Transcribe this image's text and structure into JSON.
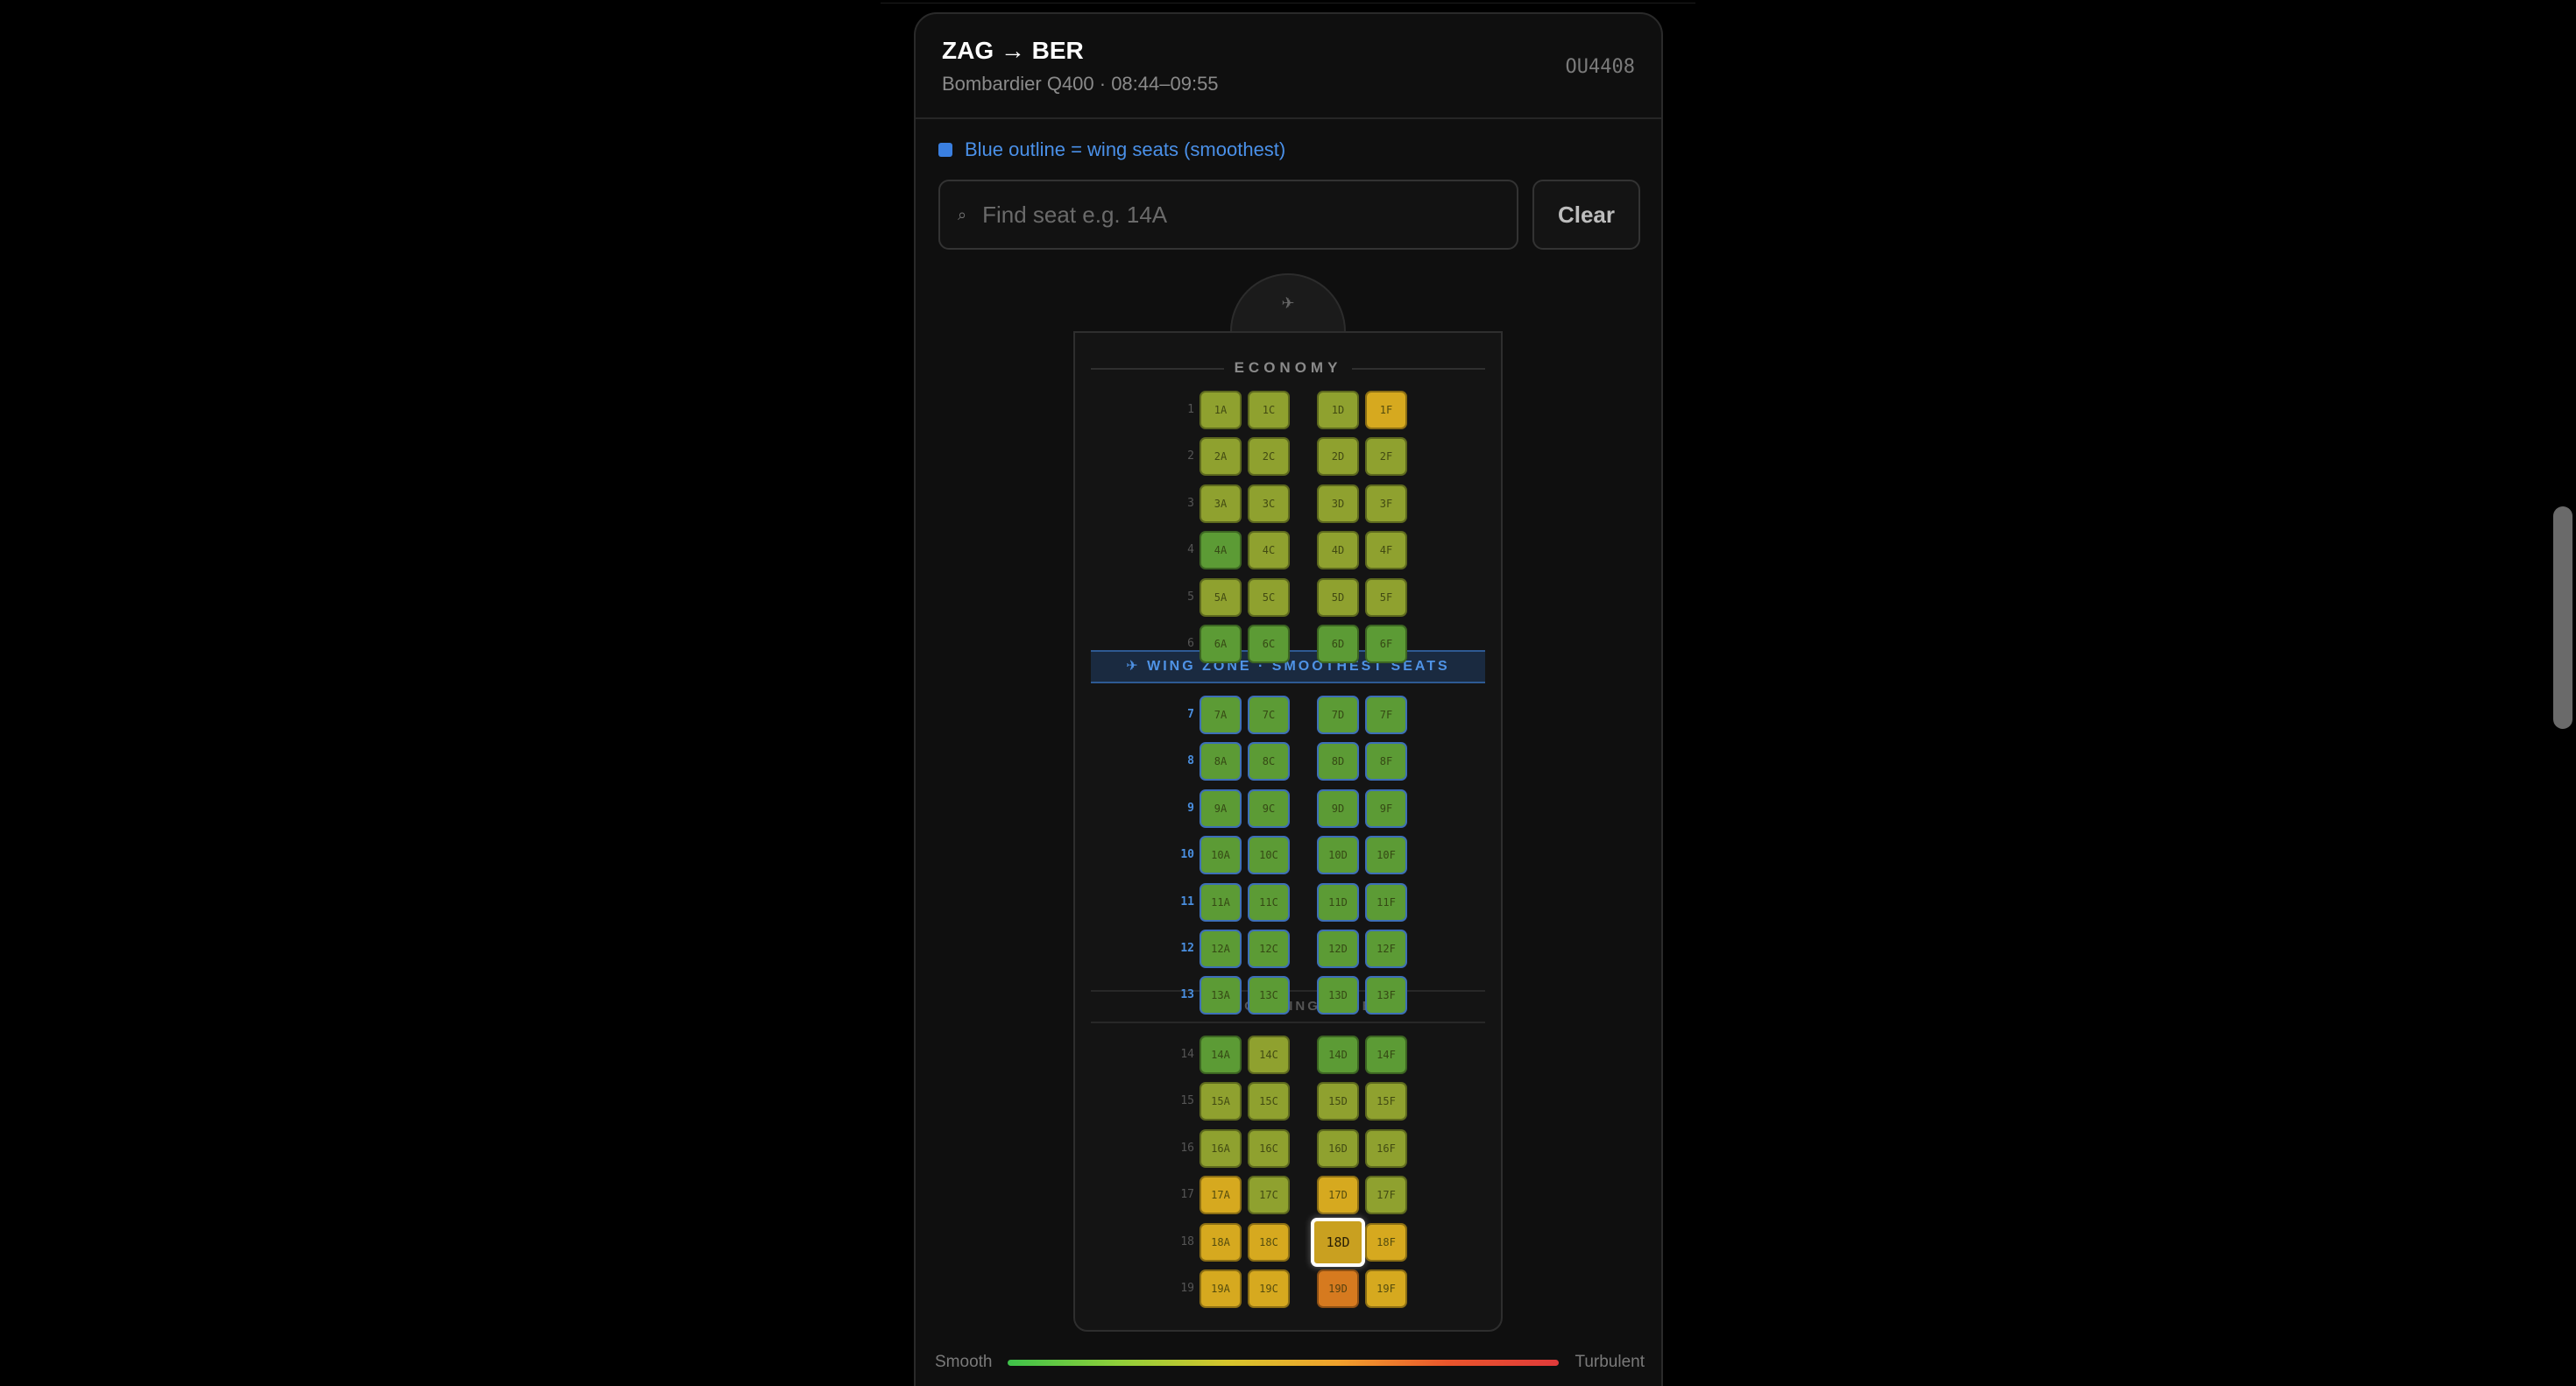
{
  "flight": {
    "route": "ZAG → BER",
    "details": "Bombardier Q400 · 08:44–09:55",
    "number": "OU4408"
  },
  "legend": {
    "text": "Blue outline = wing seats (smoothest)",
    "color": "#3a7fe0"
  },
  "search": {
    "icon": "⌕",
    "placeholder": "Find seat e.g. 14A",
    "value": ""
  },
  "clear_label": "Clear",
  "nose_icon": "✈",
  "cabin": {
    "class_label": "ECONOMY",
    "wing_banner": "✈ WING ZONE · SMOOTHEST SEATS",
    "wing_end": "END OF WING ZONE",
    "columns": [
      "A",
      "C",
      "D",
      "F"
    ],
    "wing_rows": [
      7,
      8,
      9,
      10,
      11,
      12,
      13
    ],
    "selected_seat": "18D",
    "rows": [
      {
        "row": "1",
        "seats": {
          "A": "1A",
          "C": "1C",
          "D": "1D",
          "F": "1F"
        },
        "colors": {
          "A": "#8fa12f",
          "C": "#8fa12f",
          "D": "#8fa12f",
          "F": "#d6a91f"
        }
      },
      {
        "row": "2",
        "seats": {
          "A": "2A",
          "C": "2C",
          "D": "2D",
          "F": "2F"
        },
        "colors": {
          "A": "#8fa12f",
          "C": "#8fa12f",
          "D": "#8fa12f",
          "F": "#8fa12f"
        }
      },
      {
        "row": "3",
        "seats": {
          "A": "3A",
          "C": "3C",
          "D": "3D",
          "F": "3F"
        },
        "colors": {
          "A": "#8fa12f",
          "C": "#8fa12f",
          "D": "#8fa12f",
          "F": "#8fa12f"
        }
      },
      {
        "row": "4",
        "seats": {
          "A": "4A",
          "C": "4C",
          "D": "4D",
          "F": "4F"
        },
        "colors": {
          "A": "#5c9b35",
          "C": "#8fa12f",
          "D": "#8fa12f",
          "F": "#8fa12f"
        }
      },
      {
        "row": "5",
        "seats": {
          "A": "5A",
          "C": "5C",
          "D": "5D",
          "F": "5F"
        },
        "colors": {
          "A": "#8fa12f",
          "C": "#8fa12f",
          "D": "#8fa12f",
          "F": "#8fa12f"
        }
      },
      {
        "row": "6",
        "seats": {
          "A": "6A",
          "C": "6C",
          "D": "6D",
          "F": "6F"
        },
        "colors": {
          "A": "#5c9b35",
          "C": "#5c9b35",
          "D": "#5c9b35",
          "F": "#5c9b35"
        }
      },
      {
        "row": "7",
        "seats": {
          "A": "7A",
          "C": "7C",
          "D": "7D",
          "F": "7F"
        },
        "colors": {
          "A": "#5c9b35",
          "C": "#5c9b35",
          "D": "#5c9b35",
          "F": "#5c9b35"
        }
      },
      {
        "row": "8",
        "seats": {
          "A": "8A",
          "C": "8C",
          "D": "8D",
          "F": "8F"
        },
        "colors": {
          "A": "#5c9b35",
          "C": "#5c9b35",
          "D": "#5c9b35",
          "F": "#5c9b35"
        }
      },
      {
        "row": "9",
        "seats": {
          "A": "9A",
          "C": "9C",
          "D": "9D",
          "F": "9F"
        },
        "colors": {
          "A": "#5c9b35",
          "C": "#5c9b35",
          "D": "#5c9b35",
          "F": "#5c9b35"
        }
      },
      {
        "row": "10",
        "seats": {
          "A": "10A",
          "C": "10C",
          "D": "10D",
          "F": "10F"
        },
        "colors": {
          "A": "#5c9b35",
          "C": "#5c9b35",
          "D": "#5c9b35",
          "F": "#5c9b35"
        }
      },
      {
        "row": "11",
        "seats": {
          "A": "11A",
          "C": "11C",
          "D": "11D",
          "F": "11F"
        },
        "colors": {
          "A": "#5c9b35",
          "C": "#5c9b35",
          "D": "#5c9b35",
          "F": "#5c9b35"
        }
      },
      {
        "row": "12",
        "seats": {
          "A": "12A",
          "C": "12C",
          "D": "12D",
          "F": "12F"
        },
        "colors": {
          "A": "#5c9b35",
          "C": "#5c9b35",
          "D": "#5c9b35",
          "F": "#5c9b35"
        }
      },
      {
        "row": "13",
        "seats": {
          "A": "13A",
          "C": "13C",
          "D": "13D",
          "F": "13F"
        },
        "colors": {
          "A": "#5c9b35",
          "C": "#5c9b35",
          "D": "#5c9b35",
          "F": "#5c9b35"
        }
      },
      {
        "row": "14",
        "seats": {
          "A": "14A",
          "C": "14C",
          "D": "14D",
          "F": "14F"
        },
        "colors": {
          "A": "#5c9b35",
          "C": "#8fa12f",
          "D": "#5c9b35",
          "F": "#5c9b35"
        }
      },
      {
        "row": "15",
        "seats": {
          "A": "15A",
          "C": "15C",
          "D": "15D",
          "F": "15F"
        },
        "colors": {
          "A": "#8fa12f",
          "C": "#8fa12f",
          "D": "#8fa12f",
          "F": "#8fa12f"
        }
      },
      {
        "row": "16",
        "seats": {
          "A": "16A",
          "C": "16C",
          "D": "16D",
          "F": "16F"
        },
        "colors": {
          "A": "#8fa12f",
          "C": "#8fa12f",
          "D": "#8fa12f",
          "F": "#8fa12f"
        }
      },
      {
        "row": "17",
        "seats": {
          "A": "17A",
          "C": "17C",
          "D": "17D",
          "F": "17F"
        },
        "colors": {
          "A": "#d6a91f",
          "C": "#8fa12f",
          "D": "#d6a91f",
          "F": "#8fa12f"
        }
      },
      {
        "row": "18",
        "seats": {
          "A": "18A",
          "C": "18C",
          "D": "18D",
          "F": "18F"
        },
        "colors": {
          "A": "#d6a91f",
          "C": "#d6a91f",
          "D": "#c9a020",
          "F": "#d6a91f"
        }
      },
      {
        "row": "19",
        "seats": {
          "A": "19A",
          "C": "19C",
          "D": "19D",
          "F": "19F"
        },
        "colors": {
          "A": "#d6a91f",
          "C": "#d6a91f",
          "D": "#d67a1f",
          "F": "#d6a91f"
        }
      }
    ]
  },
  "scale": {
    "left_label": "Smooth",
    "right_label": "Turbulent"
  }
}
